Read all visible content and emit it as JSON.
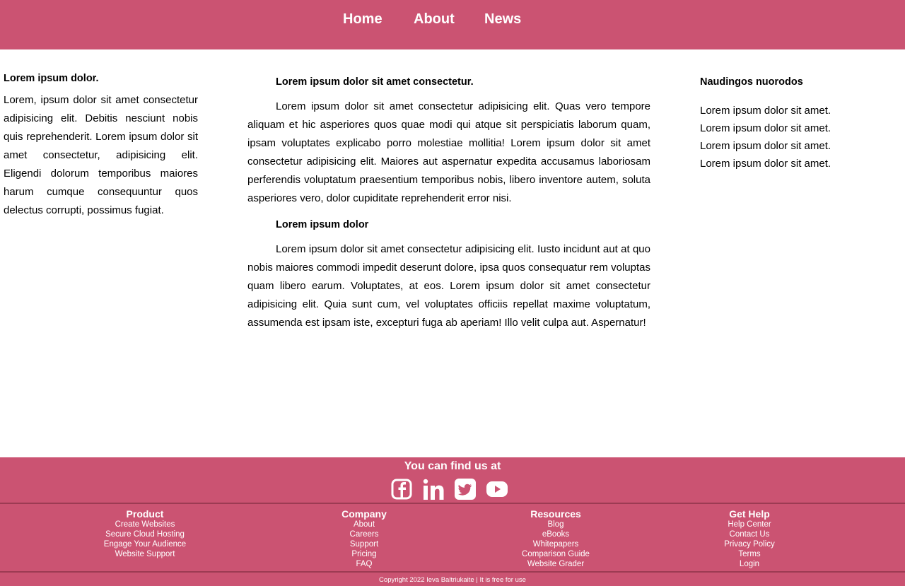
{
  "nav": {
    "items": [
      "Home",
      "About",
      "News"
    ]
  },
  "left": {
    "title": "Lorem ipsum dolor.",
    "text": "Lorem, ipsum dolor sit amet consectetur adipisicing elit. Debitis nesciunt nobis quis reprehenderit. Lorem ipsum dolor sit amet consectetur, adipisicing elit. Eligendi dolorum temporibus maiores harum cumque consequuntur quos delectus corrupti, possimus fugiat."
  },
  "main": {
    "heading1": "Lorem ipsum dolor sit amet consectetur.",
    "para1": "Lorem ipsum dolor sit amet consectetur adipisicing elit. Quas vero tempore aliquam et hic asperiores quos quae modi qui atque sit perspiciatis laborum quam, ipsam voluptates explicabo porro molestiae mollitia! Lorem ipsum dolor sit amet consectetur adipisicing elit. Maiores aut aspernatur expedita accusamus laboriosam perferendis voluptatum praesentium temporibus nobis, libero inventore autem, soluta asperiores vero, dolor cupiditate reprehenderit error nisi.",
    "heading2": "Lorem ipsum dolor",
    "para2": "Lorem ipsum dolor sit amet consectetur adipisicing elit. Iusto incidunt aut at quo nobis maiores commodi impedit deserunt dolore, ipsa quos consequatur rem voluptas quam libero earum. Voluptates, at eos. Lorem ipsum dolor sit amet consectetur adipisicing elit. Quia sunt cum, vel voluptates officiis repellat maxime voluptatum, assumenda est ipsam iste, excepturi fuga ab aperiam! Illo velit culpa aut. Aspernatur!"
  },
  "sidebar": {
    "title": "Naudingos nuorodos",
    "links": [
      "Lorem ipsum dolor sit amet.",
      "Lorem ipsum dolor sit amet.",
      "Lorem ipsum dolor sit amet.",
      "Lorem ipsum dolor sit amet."
    ]
  },
  "footer": {
    "find_us": "You can find us at",
    "social_icons": [
      "facebook-icon",
      "linkedin-icon",
      "twitter-icon",
      "youtube-icon"
    ],
    "columns": [
      {
        "title": "Product",
        "links": [
          "Create Websites",
          "Secure Cloud Hosting",
          "Engage Your Audience",
          "Website Support"
        ]
      },
      {
        "title": "Company",
        "links": [
          "About",
          "Careers",
          "Support",
          "Pricing",
          "FAQ"
        ]
      },
      {
        "title": "Resources",
        "links": [
          "Blog",
          "eBooks",
          "Whitepapers",
          "Comparison Guide",
          "Website Grader"
        ]
      },
      {
        "title": "Get Help",
        "links": [
          "Help Center",
          "Contact Us",
          "Privacy Policy",
          "Terms",
          "Login"
        ]
      }
    ],
    "copyright": "Copyright 2022 Ieva Baltriukaite | It is free for use"
  },
  "colors": {
    "brand": "#cb5372",
    "divider": "#9c3b53",
    "text": "#000000",
    "footer_text": "#ffffff"
  }
}
